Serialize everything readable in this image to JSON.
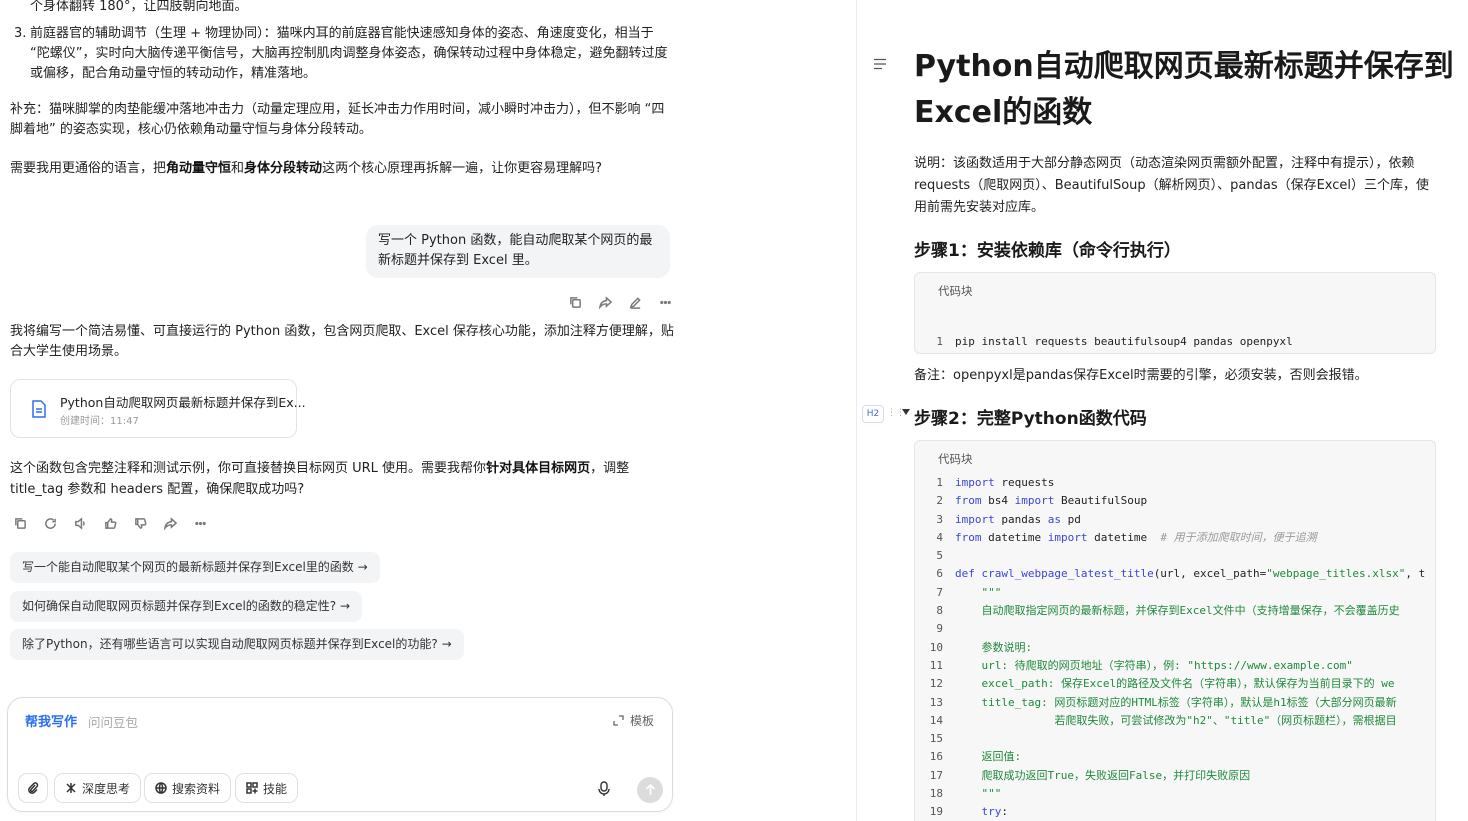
{
  "chat": {
    "top_fragment": "个身体翻转 180°，让四肢朝向地面。",
    "list_item_3_num": "3.",
    "list_item_3": "前庭器官的辅助调节（生理 + 物理协同）：猫咪内耳的前庭器官能快速感知身体的姿态、角速度变化，相当于 “陀螺仪”，实时向大脑传递平衡信号，大脑再控制肌肉调整身体姿态，确保转动过程中身体稳定，避免翻转过度或偏移，配合角动量守恒的转动动作，精准落地。",
    "supplement": "补充：猫咪脚掌的肉垫能缓冲落地冲击力（动量定理应用，延长冲击力作用时间，减小瞬时冲击力），但不影响 “四脚着地” 的姿态实现，核心仍依赖角动量守恒与身体分段转动。",
    "followup_before": "需要我用更通俗的语言，把",
    "followup_bold1": "角动量守恒",
    "followup_mid": "和",
    "followup_bold2": "身体分段转动",
    "followup_after": "这两个核心原理再拆解一遍，让你更容易理解吗?",
    "user_message": "写一个 Python 函数，能自动爬取某个网页的最新标题并保存到 Excel 里。",
    "intro": "我将编写一个简洁易懂、可直接运行的 Python 函数，包含网页爬取、Excel 保存核心功能，添加注释方便理解，贴合大学生使用场景。",
    "doc_card": {
      "title": "Python自动爬取网页最新标题并保存到Ex...",
      "time": "创建时间：11:47"
    },
    "closing_before": "这个函数包含完整注释和测试示例，你可直接替换目标网页 URL 使用。需要我帮你",
    "closing_bold": "针对具体目标网页",
    "closing_after": "，调整 title_tag 参数和 headers 配置，确保爬取成功吗?",
    "suggestions": [
      "写一个能自动爬取某个网页的最新标题并保存到Excel里的函数 →",
      "如何确保自动爬取网页标题并保存到Excel的函数的稳定性? →",
      "除了Python，还有哪些语言可以实现自动爬取网页标题并保存到Excel的功能? →"
    ]
  },
  "composer": {
    "mode_label": "帮我写作",
    "placeholder": "问问豆包",
    "template_label": "模板",
    "buttons": [
      "深度思考",
      "搜索资料",
      "技能"
    ]
  },
  "doc": {
    "title": "Python自动爬取网页最新标题并保存到Excel的函数",
    "note": "说明：该函数适用于大部分静态网页（动态渲染网页需额外配置，注释中有提示），依赖requests（爬取网页）、BeautifulSoup（解析网页）、pandas（保存Excel）三个库，使用前需先安装对应库。",
    "step1": "步骤1：安装依赖库（命令行执行）",
    "code_label": "代码块",
    "install_cmd": "pip install requests beautifulsoup4 pandas openpyxl",
    "remark": "备注：openpyxl是pandas保存Excel时需要的引擎，必须安装，否则会报错。",
    "heading_badge": "H2",
    "step2": "步骤2：完整Python函数代码",
    "code2_label": "代码块",
    "code_lines": [
      "import requests",
      "from bs4 import BeautifulSoup",
      "import pandas as pd",
      "from datetime import datetime  # 用于添加爬取时间，便于追溯",
      "",
      "def crawl_webpage_latest_title(url, excel_path=\"webpage_titles.xlsx\", t",
      "    \"\"\"",
      "    自动爬取指定网页的最新标题，并保存到Excel文件中（支持增量保存，不会覆盖历史",
      "",
      "    参数说明:",
      "    url: 待爬取的网页地址（字符串），例: \"https://www.example.com\"",
      "    excel_path: 保存Excel的路径及文件名（字符串），默认保存为当前目录下的 we",
      "    title_tag: 网页标题对应的HTML标签（字符串），默认是h1标签（大部分网页最新",
      "               若爬取失败，可尝试修改为\"h2\"、\"title\"（网页标题栏），需根据目",
      "",
      "    返回值:",
      "    爬取成功返回True，失败返回False，并打印失败原因",
      "    \"\"\"",
      "    try:"
    ]
  }
}
